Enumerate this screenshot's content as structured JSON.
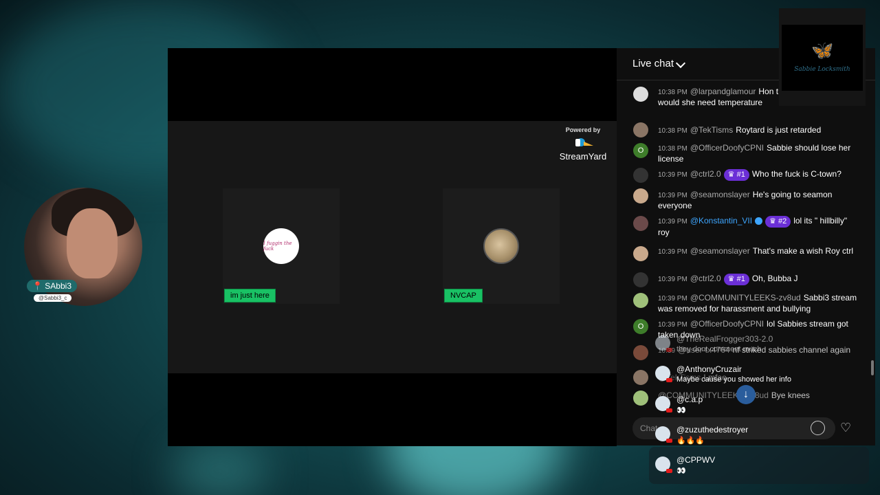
{
  "stage": {
    "powered_by": "Powered by",
    "streamyard": "StreamYard",
    "participants": [
      {
        "avatar_text": "I fuggin the fuck",
        "name": "im just here"
      },
      {
        "avatar_text": "",
        "name": "NVCAP"
      }
    ]
  },
  "webcam": {
    "tag": "SAbbi3",
    "handle": "@Sabbi3_c"
  },
  "brand": {
    "text": "Sabbie Locksmith"
  },
  "chat": {
    "title": "Live chat",
    "input_placeholder": "Chat...",
    "messages": [
      {
        "time": "10:38 PM",
        "user": "@larpandglamour",
        "text": "Hon thermostats why would she need temperature"
      },
      {
        "time": "10:38 PM",
        "user": "@TekTisms",
        "text": "Roytard is just retarded"
      },
      {
        "time": "10:38 PM",
        "user": "@OfficerDoofyCPNI",
        "text": "Sabbie should lose her license",
        "avatar_letter": "O"
      },
      {
        "time": "10:39 PM",
        "user": "@ctrl2.0",
        "badge": "#1",
        "text": "Who the fuck is C-town?"
      },
      {
        "time": "10:39 PM",
        "user": "@seamonslayer",
        "text": "He's going to seamon everyone"
      },
      {
        "time": "10:39 PM",
        "user": "@Konstantin_VII",
        "badge": "#2",
        "text": "lol its \" hillbilly\" roy"
      },
      {
        "time": "10:39 PM",
        "user": "@seamonslayer",
        "text": "That's make a wish Roy ctrl"
      },
      {
        "time": "10:39 PM",
        "user": "@ctrl2.0",
        "badge": "#1",
        "text": "Oh, Bubba J"
      },
      {
        "time": "10:39 PM",
        "user": "@COMMUNITYLEEKS-zv8ud",
        "text": "Sabbi3 stream was removed for harassment and bullying"
      },
      {
        "time": "10:39 PM",
        "user": "@OfficerDoofyCPNI",
        "text": "lol Sabbies stream got taken down",
        "avatar_letter": "O"
      },
      {
        "time": "10:39",
        "user": "@user-tx4764",
        "text": "nf striked sabbies channel again"
      },
      {
        "time": "",
        "user": "@TekTisms",
        "text": "Lmfao"
      },
      {
        "time": "",
        "user": "@COMMUNITYLEEKS-zv8ud",
        "text": "Bye knees"
      }
    ]
  },
  "overlay": [
    {
      "user": "@TheRealFrogger303-2.0",
      "text": "they dont comment much"
    },
    {
      "user": "@AnthonyCruzair",
      "text": "Maybe cause you showed her info"
    },
    {
      "user": "@c.a.p",
      "text": "👀"
    },
    {
      "user": "@zuzuthedestroyer",
      "text": "🔥🔥🔥"
    },
    {
      "user": "@CPPWV",
      "text": "👀"
    }
  ]
}
